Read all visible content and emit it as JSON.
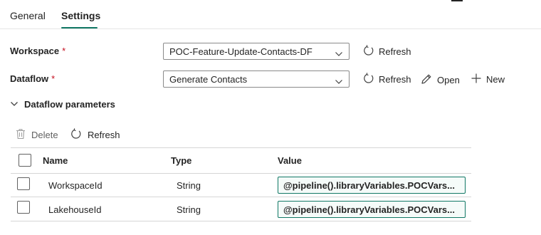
{
  "tabs": [
    {
      "label": "General",
      "active": false
    },
    {
      "label": "Settings",
      "active": true
    }
  ],
  "form": {
    "workspace": {
      "label": "Workspace",
      "required_mark": "*",
      "value": "POC-Feature-Update-Contacts-DF",
      "refresh_label": "Refresh"
    },
    "dataflow": {
      "label": "Dataflow",
      "required_mark": "*",
      "value": "Generate Contacts",
      "refresh_label": "Refresh",
      "open_label": "Open",
      "new_label": "New"
    }
  },
  "section": {
    "label": "Dataflow parameters",
    "expanded": true
  },
  "toolbar": {
    "delete_label": "Delete",
    "refresh_label": "Refresh"
  },
  "table": {
    "columns": [
      "Name",
      "Type",
      "Value"
    ],
    "rows": [
      {
        "name": "WorkspaceId",
        "type": "String",
        "value": "@pipeline().libraryVariables.POCVars..."
      },
      {
        "name": "LakehouseId",
        "type": "String",
        "value": "@pipeline().libraryVariables.POCVars..."
      }
    ]
  },
  "colors": {
    "accent": "#117865",
    "required": "#c50f1f",
    "text": "#242424",
    "value_bg": "#f5fbf9"
  },
  "icons": [
    "refresh-icon",
    "chevron-down-icon",
    "pencil-icon",
    "plus-icon",
    "trash-icon"
  ]
}
